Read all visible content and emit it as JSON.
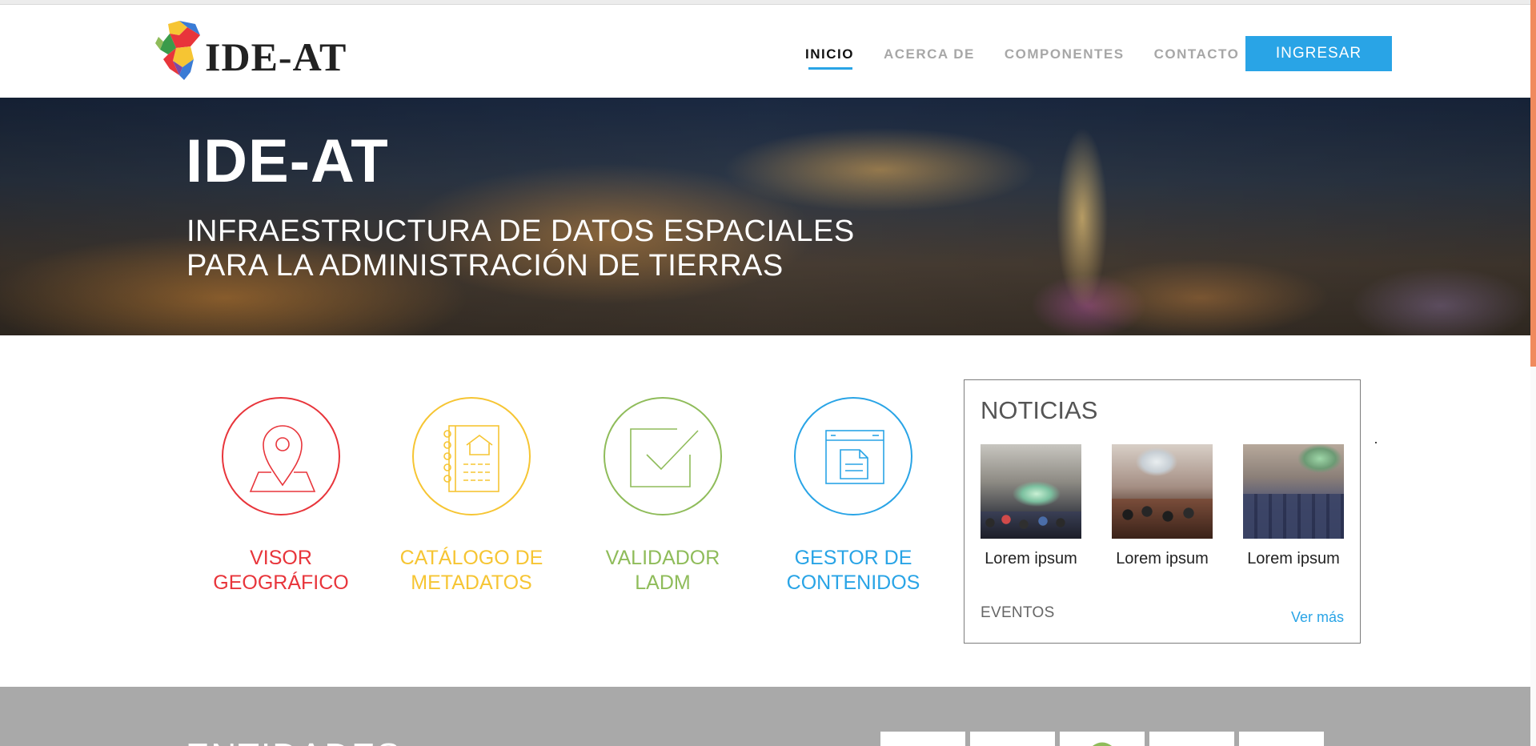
{
  "brand": {
    "name": "IDE-AT"
  },
  "nav": {
    "items": [
      {
        "label": "INICIO",
        "active": true
      },
      {
        "label": "ACERCA DE",
        "active": false
      },
      {
        "label": "COMPONENTES",
        "active": false
      },
      {
        "label": "CONTACTO",
        "active": false
      }
    ],
    "login_label": "INGRESAR"
  },
  "hero": {
    "title": "IDE-AT",
    "subtitle_line1": "INFRAESTRUCTURA DE DATOS ESPACIALES",
    "subtitle_line2": "PARA LA ADMINISTRACIÓN DE TIERRAS"
  },
  "services": [
    {
      "line1": "VISOR",
      "line2": "GEOGRÁFICO",
      "color": "#e8353b",
      "icon": "map-pin-icon"
    },
    {
      "line1": "CATÁLOGO DE",
      "line2": "METADATOS",
      "color": "#f6c533",
      "icon": "catalog-book-icon"
    },
    {
      "line1": "VALIDADOR",
      "line2": "LADM",
      "color": "#8fbc5a",
      "icon": "checkbox-check-icon"
    },
    {
      "line1": "GESTOR DE",
      "line2": "CONTENIDOS",
      "color": "#29a4e6",
      "icon": "document-window-icon"
    }
  ],
  "news": {
    "title": "NOTICIAS",
    "items": [
      {
        "caption": "Lorem ipsum"
      },
      {
        "caption": "Lorem ipsum"
      },
      {
        "caption": "Lorem ipsum"
      }
    ],
    "events_label": "EVENTOS",
    "more_label": "Ver más"
  },
  "entities": {
    "title": "ENTIDADES"
  },
  "colors": {
    "accent": "#29a4e6",
    "scroll_thumb": "#f08a5d",
    "footer_band": "#a9a9a9"
  }
}
